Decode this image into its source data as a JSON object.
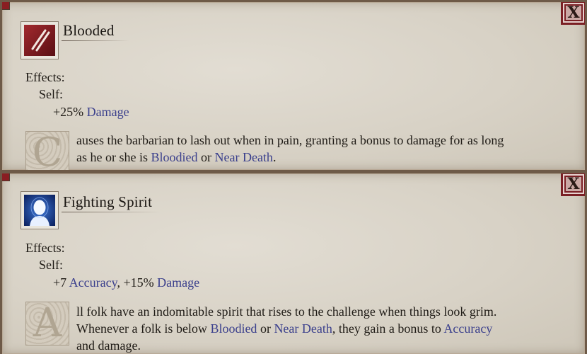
{
  "close_label": "X",
  "colors": {
    "keyword": "#3a3f8c",
    "close_border": "#7a1f24"
  },
  "abilities": [
    {
      "icon": "claw-slash-icon",
      "title": "Blooded",
      "effects_label": "Effects:",
      "target_label": "Self:",
      "effect_line": {
        "prefix": "+25% ",
        "keyword": "Damage"
      },
      "drop_cap": "C",
      "desc_line1": "auses the barbarian to lash out when in pain, granting a bonus to damage for as long",
      "desc_line2_a": "as he or she is ",
      "desc_kw1": "Bloodied",
      "desc_line2_b": " or ",
      "desc_kw2": "Near Death",
      "desc_line2_c": "."
    },
    {
      "icon": "glowing-face-icon",
      "title": "Fighting Spirit",
      "effects_label": "Effects:",
      "target_label": "Self:",
      "effect_line": {
        "prefix": "+7 ",
        "keyword": "Accuracy",
        "mid": ", +15% ",
        "keyword2": "Damage"
      },
      "drop_cap": "A",
      "desc_line1": "ll folk have an indomitable spirit that rises to the challenge when things look grim.",
      "desc_line2_a": "Whenever a folk is below ",
      "desc_kw1": "Bloodied",
      "desc_line2_b": " or ",
      "desc_kw2": "Near Death",
      "desc_line2_c": ", they gain a bonus to ",
      "desc_kw3": "Accuracy",
      "desc_line3": "and damage."
    }
  ]
}
